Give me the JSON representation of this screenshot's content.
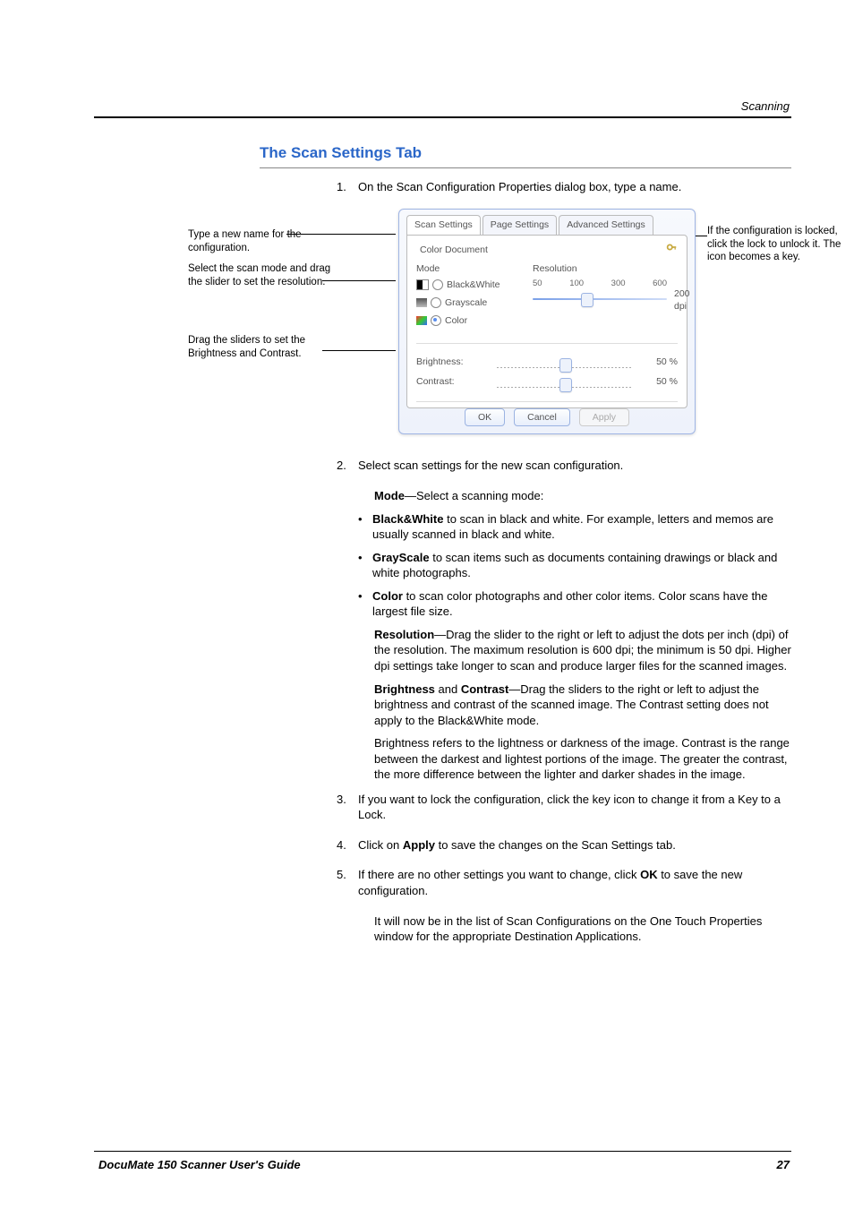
{
  "page": {
    "chapter_label": "Scanning",
    "section_title": "The Scan Settings Tab",
    "footer_left": "DocuMate 150 Scanner User's Guide",
    "footer_right": "27"
  },
  "steps": {
    "s1": "On the Scan Configuration Properties dialog box, type a name.",
    "s2": "Select scan settings for the new scan configuration.",
    "s3": "If you want to lock the configuration, click the key icon to change it from a Key to a Lock.",
    "s4_pre": "Click on ",
    "s4_bold": "Apply",
    "s4_post": " to save the changes on the Scan Settings tab.",
    "s5_pre": "If there are no other settings you want to change, click ",
    "s5_bold": "OK",
    "s5_post": " to save the new configuration.",
    "s5_follow": "It will now be in the list of Scan Configurations on the One Touch Properties window for the appropriate Destination Applications."
  },
  "settings_text": {
    "mode_label": "Mode",
    "mode_intro": "—Select a scanning mode:",
    "bw_bold": "Black&White",
    "bw_rest": " to scan in black and white. For example, letters and memos are usually scanned in black and white.",
    "gs_bold": "GrayScale",
    "gs_rest": " to scan items such as documents containing drawings or black and white photographs.",
    "co_bold": "Color",
    "co_rest": " to scan color photographs and other color items. Color scans have the largest file size.",
    "res_bold": "Resolution",
    "res_rest": "—Drag the slider to the right or left to adjust the dots per inch (dpi) of the resolution. The maximum resolution is 600 dpi; the minimum is 50 dpi. Higher dpi settings take longer to scan and produce larger files for the scanned images.",
    "bri_bold": "Brightness",
    "bc_and": " and ",
    "con_bold": "Contrast",
    "bc_rest": "—Drag the sliders to the right or left to adjust the brightness and contrast of the scanned image. The Contrast setting does not apply to the Black&White mode.",
    "bc_follow": "Brightness refers to the lightness or darkness of the image. Contrast is the range between the darkest and lightest portions of the image. The greater the contrast, the more difference between the lighter and darker shades in the image."
  },
  "callouts": {
    "left1": "Type a new name for the configuration.",
    "left2": "Select the scan mode and drag the slider to set the resolution.",
    "left3": "Drag the sliders to set the Brightness and Contrast.",
    "right1": "If the configuration is locked, click the lock to unlock it. The icon becomes a key."
  },
  "dialog": {
    "tabs": {
      "scan": "Scan Settings",
      "page": "Page Settings",
      "adv": "Advanced Settings"
    },
    "config_name": "Color Document",
    "mode_header": "Mode",
    "res_header": "Resolution",
    "modes": {
      "bw": "Black&White",
      "gs": "Grayscale",
      "co": "Color"
    },
    "ticks": {
      "t50": "50",
      "t100": "100",
      "t300": "300",
      "t600": "600"
    },
    "res_value": "200 dpi",
    "brightness_label": "Brightness:",
    "contrast_label": "Contrast:",
    "brightness_value": "50 %",
    "contrast_value": "50 %",
    "buttons": {
      "ok": "OK",
      "cancel": "Cancel",
      "apply": "Apply"
    }
  },
  "numbers": {
    "n1": "1.",
    "n2": "2.",
    "n3": "3.",
    "n4": "4.",
    "n5": "5."
  }
}
